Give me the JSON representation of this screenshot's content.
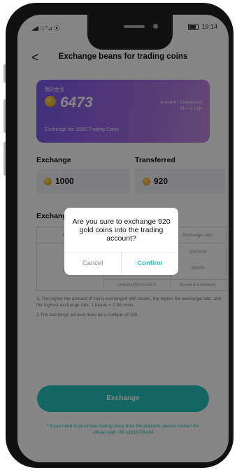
{
  "status": {
    "left": "□ °⊿ ⦿",
    "time": "19:14"
  },
  "header": {
    "back": "<",
    "title": "Exchange beans for trading coins"
  },
  "card": {
    "label": "我的金豆",
    "balance": "6473",
    "detail": "Amount | Chenpcash\n1$ = 1 Coin",
    "rate": "Exchange for: 5955 Trading Coins"
  },
  "exchange": {
    "label": "Exchange",
    "value": "1000"
  },
  "transferred": {
    "label": "Transferred",
    "value": "920"
  },
  "records": {
    "title": "Exchange",
    "headers": [
      "Exchan",
      "",
      "Exchange ratio"
    ],
    "rows": [
      [
        "Game",
        "",
        "2000009"
      ],
      [
        "amount",
        "",
        "80009"
      ],
      [
        "",
        "Amount(0)XXXXXX",
        "Exceed 5 Amount"
      ]
    ]
  },
  "rules": [
    "1. The higher the amount of coins exchanged with beans, the higher the exchange rate, and the highest exchange rate: 1 beans = 0.98 coins.",
    "2.The exchange amount must be a multiple of 100."
  ],
  "button": {
    "label": "Exchange"
  },
  "note": "* If you need to purchase trading coins from the platform, please contact the official staff +86 13816789234",
  "dialog": {
    "message": "Are you sure to exchange 920 gold coins into the trading account?",
    "cancel": "Cancel",
    "confirm": "Confirm"
  },
  "colors": {
    "accent": "#28c4c0",
    "card_start": "#7b5cf0",
    "card_end": "#c08ade"
  }
}
